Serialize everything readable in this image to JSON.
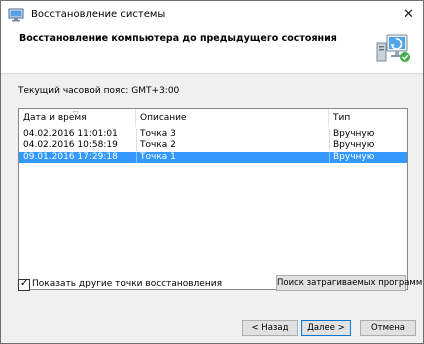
{
  "window": {
    "title": "Восстановление системы",
    "close_glyph": "✕"
  },
  "header": {
    "title": "Восстановление компьютера до предыдущего состояния"
  },
  "timezone_label": "Текущий часовой пояс: GMT+3:00",
  "table": {
    "columns": [
      "Дата и время",
      "Описание",
      "Тип"
    ],
    "rows": [
      {
        "date": "04.02.2016 11:01:01",
        "description": "Точка 3",
        "type": "Вручную",
        "selected": false
      },
      {
        "date": "04.02.2016 10:58:19",
        "description": "Точка 2",
        "type": "Вручную",
        "selected": false
      },
      {
        "date": "09.01.2016 17:29:18",
        "description": "Точка 1",
        "type": "Вручную",
        "selected": true
      }
    ]
  },
  "show_more": {
    "label": "Показать другие точки восстановления",
    "checked": true,
    "check_glyph": "✓"
  },
  "buttons": {
    "scan": "Поиск затрагиваемых программ",
    "back": "< Назад",
    "next": "Далее >",
    "cancel": "Отмена"
  },
  "colors": {
    "selection": "#3399ff",
    "default_button_border": "#0078d7",
    "panel": "#f0f0f0"
  },
  "icons": {
    "app": "system-restore-icon",
    "wizard": "system-restore-monitor-icon",
    "close": "close-icon"
  }
}
